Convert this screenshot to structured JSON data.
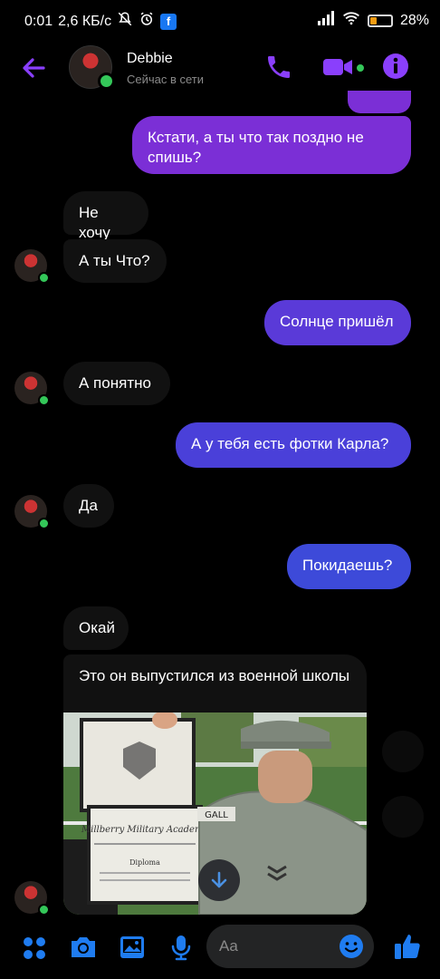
{
  "status_bar": {
    "time": "0:01",
    "speed": "2,6 КБ/с",
    "fb_badge": "f",
    "battery_text": "28%",
    "battery_level": 0.28
  },
  "header": {
    "contact_name": "Debbie",
    "presence": "Сейчас в сети"
  },
  "messages": [
    {
      "dir": "out",
      "text": "Кстати, а ты что так поздно не спишь?"
    },
    {
      "dir": "in",
      "text": "Не хочу"
    },
    {
      "dir": "in",
      "text": "А ты Что?"
    },
    {
      "dir": "out",
      "text": "Солнце пришёл"
    },
    {
      "dir": "in",
      "text": "А понятно"
    },
    {
      "dir": "out",
      "text": "А у тебя есть фотки Карла?"
    },
    {
      "dir": "in",
      "text": "Да"
    },
    {
      "dir": "out",
      "text": "Покидаешь?"
    },
    {
      "dir": "in",
      "text": "Окай"
    },
    {
      "dir": "in",
      "text": "Это он выпустился из военной школы"
    }
  ],
  "photo": {
    "diploma_line1": "Millberry Military Academy",
    "diploma_line2": "Diploma",
    "name_tag": "GALL"
  },
  "composer": {
    "placeholder": "Aa"
  },
  "colors": {
    "accent": "#8a3ffc",
    "out_top": "#7b2fd6",
    "out_bottom": "#3d4ad9",
    "online": "#34c759",
    "like": "#1f7cf0"
  }
}
